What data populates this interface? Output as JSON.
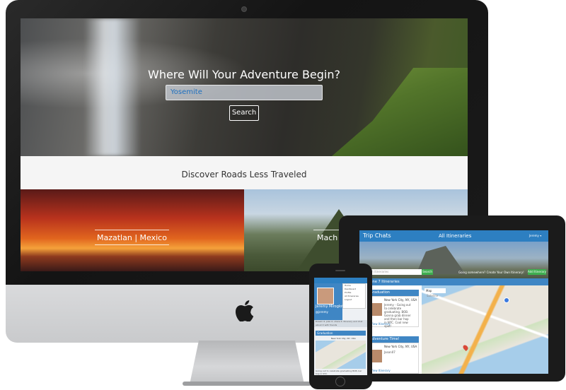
{
  "desktop": {
    "hero": {
      "title": "Where Will Your Adventure Begin?",
      "search_value": "Yosemite",
      "search_button": "Search"
    },
    "section_title": "Discover Roads Less Traveled",
    "destinations": [
      {
        "label": "Mazatlan | Mexico"
      },
      {
        "label": "Mach"
      }
    ]
  },
  "tablet": {
    "brand": "Trip Chats",
    "nav_title": "All Itineraries",
    "user_menu": "Jeremy ▾",
    "search_placeholder": "Search itineraries",
    "search_button": "Search",
    "cta_text": "Going somewhere? Create Your Own Itinerary!",
    "cta_button": "Add Itinerary",
    "strip_text": "June 7 Itineraries",
    "cards": [
      {
        "title": "Graduation",
        "location": "New York City, NY, USA",
        "author": "Jeremy",
        "excerpt": "Jeremy - Going out to celebrate graduating. BOB. Gonna grab dinner and then bar hop in NYC. Cool new spot!",
        "link": "View Itinerary"
      },
      {
        "title": "Adventure Time!",
        "location": "New York City, NY, USA",
        "author": "Jason07",
        "excerpt": "",
        "link": "View Itinerary"
      }
    ],
    "map_tabs": [
      "Map",
      "Satellite"
    ]
  },
  "phone": {
    "menu_items": [
      "Home",
      "Dashboard",
      "Profile",
      "All Itineraries",
      "Logout"
    ],
    "user_name": "Jeremy Miroglotta",
    "user_handle": "@jeremy",
    "band_text": "Dream it, plan it, share it. Itinerary and chat about it with friends",
    "card_title": "Graduation",
    "card_location": "New York City, NY, USA",
    "bottom_text": "Going out to celebrate graduating BOB, bar hop in NYC"
  },
  "colors": {
    "accent_blue": "#2d7fc1",
    "action_green": "#3eae4f",
    "search_text_blue": "#1d6fbf"
  },
  "icons": [
    "apple-logo-icon",
    "map-pin-icon",
    "location-dot-icon"
  ]
}
